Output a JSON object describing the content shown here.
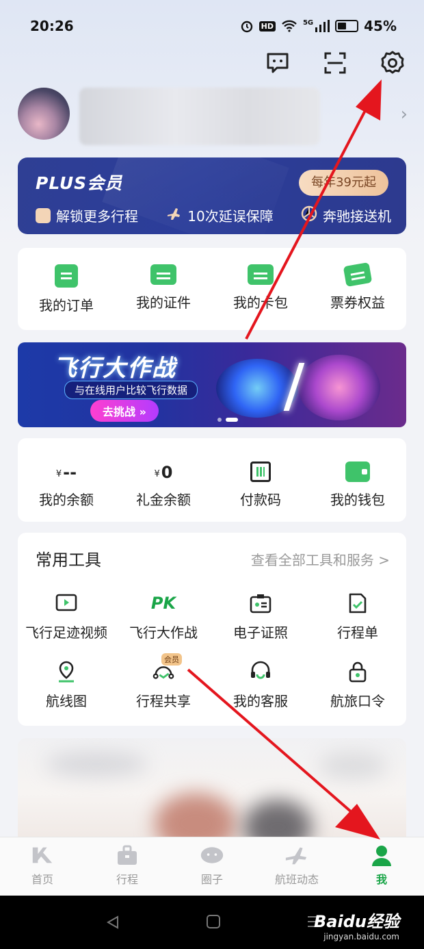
{
  "status_bar": {
    "time": "20:26",
    "hd": "HD",
    "network": "5G",
    "battery": "45%",
    "battery_level": 0.45
  },
  "header_icons": [
    "message-icon",
    "scan-icon",
    "settings-icon"
  ],
  "plus": {
    "title": "PLUS会员",
    "price": "每年39元起",
    "benefits": [
      {
        "icon": "ticket-icon",
        "label": "解锁更多行程"
      },
      {
        "icon": "delay-plane-icon",
        "label": "10次延误保障"
      },
      {
        "icon": "benz-icon",
        "label": "奔驰接送机"
      }
    ]
  },
  "quick": [
    {
      "icon": "clipboard-icon",
      "label": "我的订单"
    },
    {
      "icon": "id-card-icon",
      "label": "我的证件"
    },
    {
      "icon": "card-holder-icon",
      "label": "我的卡包"
    },
    {
      "icon": "coupon-icon",
      "label": "票券权益"
    }
  ],
  "banner": {
    "title": "飞行大作战",
    "subtitle": "与在线用户比较飞行数据",
    "button": "去挑战 »",
    "pages": 2,
    "active_page": 2
  },
  "wallet": [
    {
      "currency": "¥",
      "amount": "--",
      "label": "我的余额"
    },
    {
      "currency": "¥",
      "amount": "0",
      "label": "礼金余额"
    },
    {
      "icon": "pay-code-icon",
      "label": "付款码"
    },
    {
      "icon": "wallet-icon",
      "label": "我的钱包"
    }
  ],
  "tools": {
    "title": "常用工具",
    "more": "查看全部工具和服务 >",
    "row1": [
      {
        "icon": "video-icon",
        "label": "飞行足迹视频"
      },
      {
        "icon": "pk-icon",
        "icon_text": "PK",
        "label": "飞行大作战"
      },
      {
        "icon": "certificate-icon",
        "label": "电子证照"
      },
      {
        "icon": "itinerary-icon",
        "label": "行程单"
      }
    ],
    "row2": [
      {
        "icon": "route-map-icon",
        "label": "航线图"
      },
      {
        "icon": "share-trip-icon",
        "badge": "会员",
        "label": "行程共享"
      },
      {
        "icon": "headset-icon",
        "label": "我的客服"
      },
      {
        "icon": "lock-icon",
        "label": "航旅口令"
      }
    ]
  },
  "tabs": [
    {
      "icon": "home-icon",
      "label": "首页",
      "active": false
    },
    {
      "icon": "suitcase-icon",
      "label": "行程",
      "active": false
    },
    {
      "icon": "chat-bubble-icon",
      "label": "圈子",
      "active": false
    },
    {
      "icon": "plane-icon",
      "label": "航班动态",
      "active": false
    },
    {
      "icon": "person-icon",
      "label": "我",
      "active": true
    }
  ],
  "watermark": {
    "main": "Baidu经验",
    "sub": "jingyan.baidu.com"
  },
  "colors": {
    "accent_green": "#1aa548",
    "plus_blue": "#2f3f94",
    "annotation_red": "#e4161e"
  }
}
